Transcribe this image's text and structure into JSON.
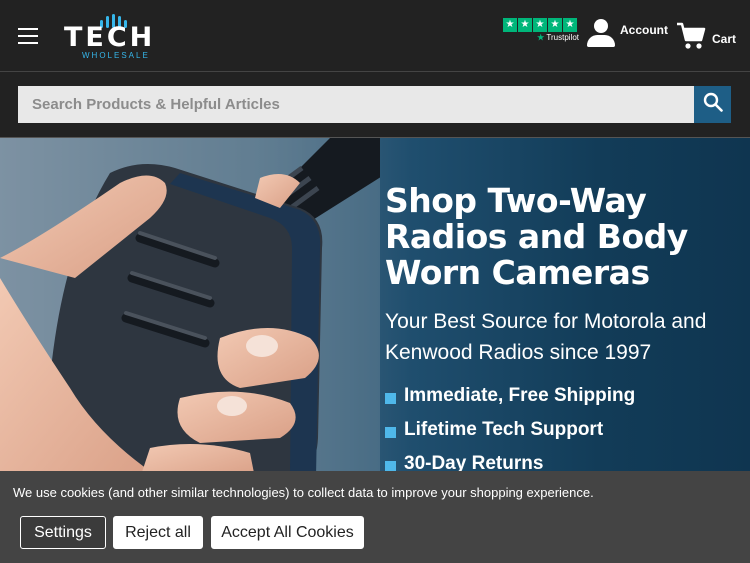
{
  "header": {
    "logo": {
      "word": "TECH",
      "sub": "WHOLESALE"
    },
    "trustpilot": {
      "stars": [
        "★",
        "★",
        "★",
        "★",
        "★"
      ],
      "label": "Trustpilot"
    },
    "account_label": "Account",
    "cart_label": "Cart",
    "icons": {
      "menu": "hamburger-icon",
      "account": "user-icon",
      "cart": "cart-icon",
      "search": "search-icon"
    }
  },
  "search": {
    "placeholder": "Search Products & Helpful Articles",
    "value": ""
  },
  "hero": {
    "title": "Shop Two-Way Radios and Body Worn Cameras",
    "subtitle": "Your Best Source for Motorola and Kenwood Radios since 1997",
    "features": [
      "Immediate, Free Shipping",
      "Lifetime Tech Support",
      "30-Day Returns"
    ]
  },
  "cookie": {
    "message": "We use cookies (and other similar technologies) to collect data to improve your shopping experience.",
    "settings_label": "Settings",
    "reject_label": "Reject all",
    "accept_label": "Accept All Cookies"
  },
  "colors": {
    "accent": "#36b6ea",
    "search_button": "#1e5e86",
    "trustpilot": "#00b67a",
    "header_bg": "#222222",
    "cookie_bg": "#444444"
  }
}
